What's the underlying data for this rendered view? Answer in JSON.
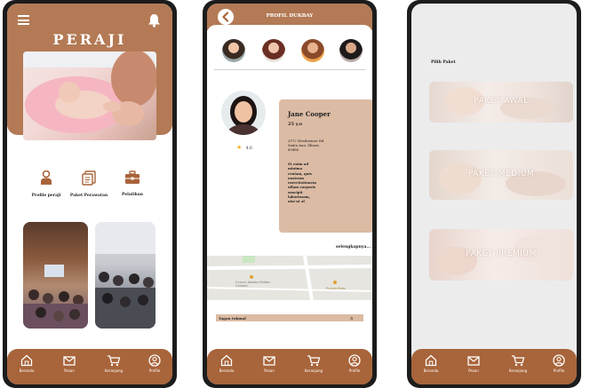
{
  "screen1": {
    "app_title": "PERAJI",
    "menu_items": [
      {
        "label": "Profile peraji",
        "icon": "person-icon"
      },
      {
        "label": "Paket Perawatan",
        "icon": "document-icon"
      },
      {
        "label": "Pelatihan",
        "icon": "briefcase-icon"
      }
    ]
  },
  "screen2": {
    "header_title": "PROFIL DUKBAY",
    "profile": {
      "name": "Jane Cooper",
      "age": "25 y.o",
      "address": "2972 Westheimer Rd. Santa Ana, Illinois 85486",
      "description": "Et enim ad minima veniam, quis nostrum exercitationem ullam corporis suscipit laboriosam, nisi ut al",
      "rating": "4.6"
    },
    "more_link": "selengkapnya...",
    "map_labels": [
      "Crunch Jakarta Hidden Cement",
      "Pramia Babu"
    ],
    "fee_label": "Tagan tukmal",
    "fee_value": "5"
  },
  "screen3": {
    "section_title": "Pilih Paket",
    "packages": [
      "PAKET AWAL",
      "PAKET MEDIUM",
      "PAKET PREMIUM"
    ]
  },
  "nav": {
    "items": [
      {
        "label": "Beranda",
        "icon": "home-icon"
      },
      {
        "label": "Pesan",
        "icon": "mail-icon"
      },
      {
        "label": "Keranjang",
        "icon": "cart-icon"
      },
      {
        "label": "Profile",
        "icon": "profile-icon"
      }
    ]
  },
  "colors": {
    "brand_brown": "#b37a55",
    "nav_brown": "#a8643a",
    "card_beige": "#dcbba4"
  }
}
